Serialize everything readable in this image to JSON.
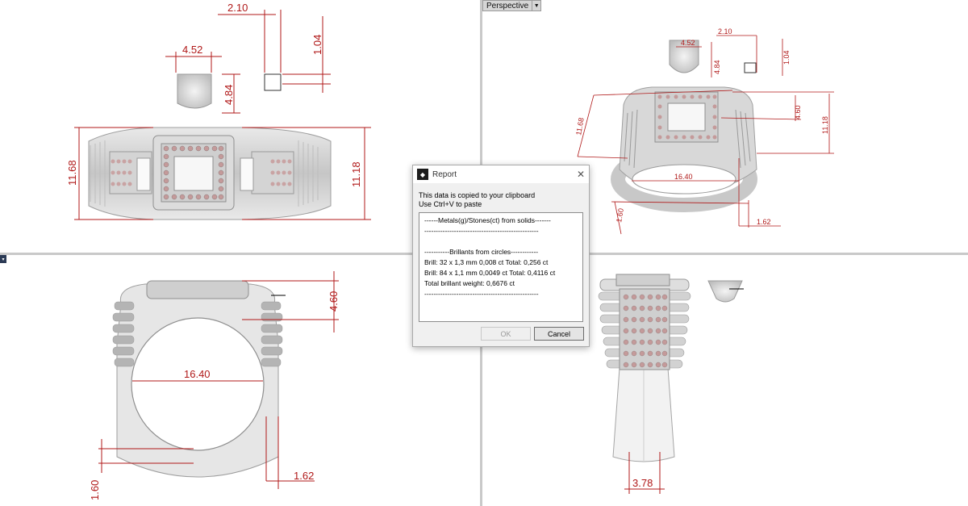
{
  "viewports": {
    "perspective_label": "Perspective",
    "top": {
      "dims": {
        "stone_w": "4.52",
        "stone_h": "4.84",
        "prong_w": "2.10",
        "prong_h": "1.04",
        "left_h": "11.68",
        "right_h": "11.18"
      }
    },
    "persp": {
      "dims": {
        "stone_w": "4.52",
        "stone_h": "4.84",
        "prong_w": "2.10",
        "prong_h": "1.04",
        "left_h": "11.68",
        "mid_h": "4.60",
        "right_h": "11.18",
        "inner_d": "16.40",
        "band_w": "1.62",
        "band_h": "1.60"
      }
    },
    "front": {
      "dims": {
        "head_h": "4.60",
        "inner_d": "16.40",
        "shank_t": "1.60",
        "shank_w": "1.62"
      }
    },
    "right": {
      "dims": {
        "shank_bottom": "3.78"
      }
    }
  },
  "report": {
    "title": "Report",
    "close_glyph": "✕",
    "message_line1": "This data is copied to your clipboard",
    "message_line2": "Use Ctrl+V to paste",
    "lines": [
      "------Metals(g)/Stones(ct) from solids-------",
      "--------------------------------------------------",
      "",
      "-----------Brillants from circles------------",
      "Brill: 32 x 1,3 mm 0,008 ct Total: 0,256 ct",
      "Brill: 84 x 1,1 mm 0,0049 ct Total: 0,4116 ct",
      "Total brillant weight: 0,6676 ct",
      "--------------------------------------------------"
    ],
    "ok_label": "OK",
    "cancel_label": "Cancel"
  },
  "colors": {
    "dimension": "#b01818",
    "viewport_border": "#c9c9c9"
  }
}
